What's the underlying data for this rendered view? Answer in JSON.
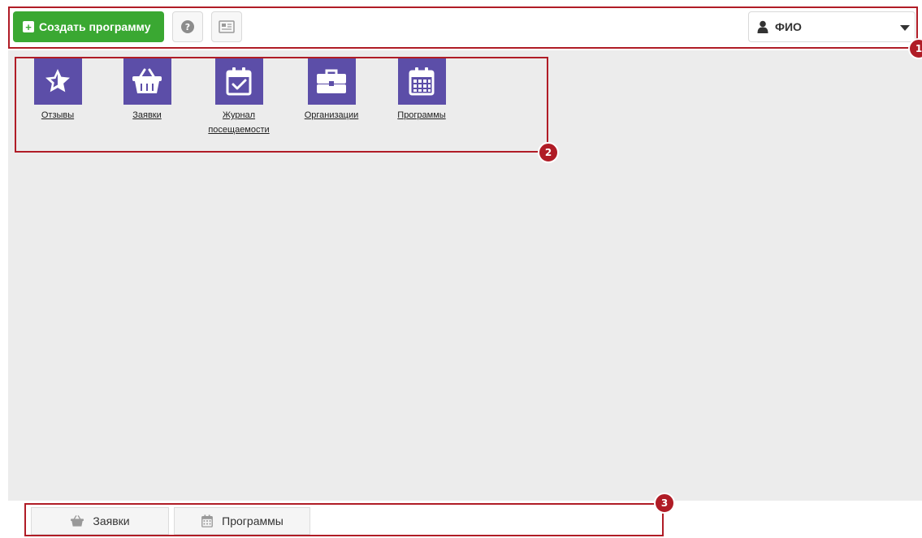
{
  "header": {
    "create_button_label": "Создать программу",
    "user_name": "ФИО"
  },
  "tiles": [
    {
      "label": "Отзывы",
      "icon": "star-icon"
    },
    {
      "label": "Заявки",
      "icon": "basket-icon"
    },
    {
      "label": "Журнал посещаемости",
      "icon": "calendar-check-icon"
    },
    {
      "label": "Организации",
      "icon": "briefcase-icon"
    },
    {
      "label": "Программы",
      "icon": "calendar-grid-icon"
    }
  ],
  "bottom_tabs": [
    {
      "label": "Заявки",
      "icon": "basket-icon"
    },
    {
      "label": "Программы",
      "icon": "calendar-grid-icon"
    }
  ],
  "annotations": [
    "1",
    "2",
    "3"
  ],
  "colors": {
    "accent_green": "#3aa832",
    "tile_purple": "#5c4ea8",
    "annotation_red": "#b01c26",
    "workspace_grey": "#ececec"
  }
}
